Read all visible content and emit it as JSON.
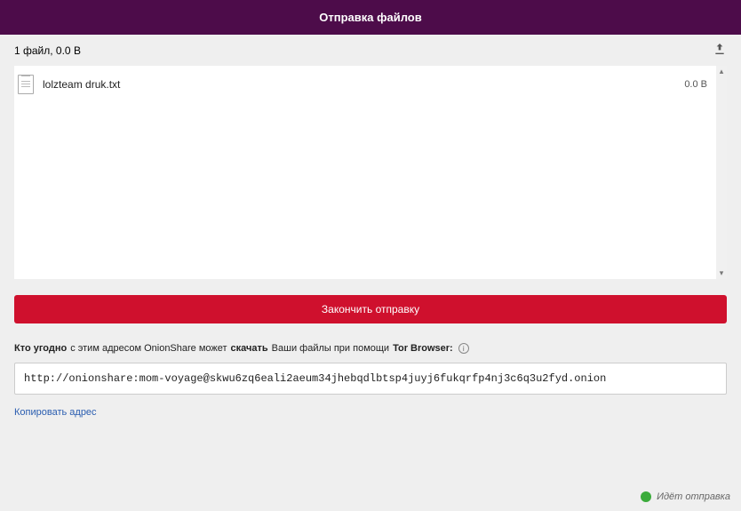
{
  "header": {
    "title": "Отправка файлов"
  },
  "summary": {
    "text": "1 файл, 0.0 B"
  },
  "files": [
    {
      "name": "lolzteam druk.txt",
      "size": "0.0 B"
    }
  ],
  "actions": {
    "stop_label": "Закончить отправку",
    "copy_label": "Копировать адрес"
  },
  "info": {
    "part1_bold": "Кто угодно",
    "part2": " с этим адресом OnionShare может ",
    "part3_bold": "скачать",
    "part4": " Ваши файлы при помощи ",
    "part5_bold": "Tor Browser:"
  },
  "share": {
    "url": "http://onionshare:mom-voyage@skwu6zq6eali2aeum34jhebqdlbtsp4juyj6fukqrfp4nj3c6q3u2fyd.onion"
  },
  "status": {
    "text": "Идёт отправка"
  }
}
